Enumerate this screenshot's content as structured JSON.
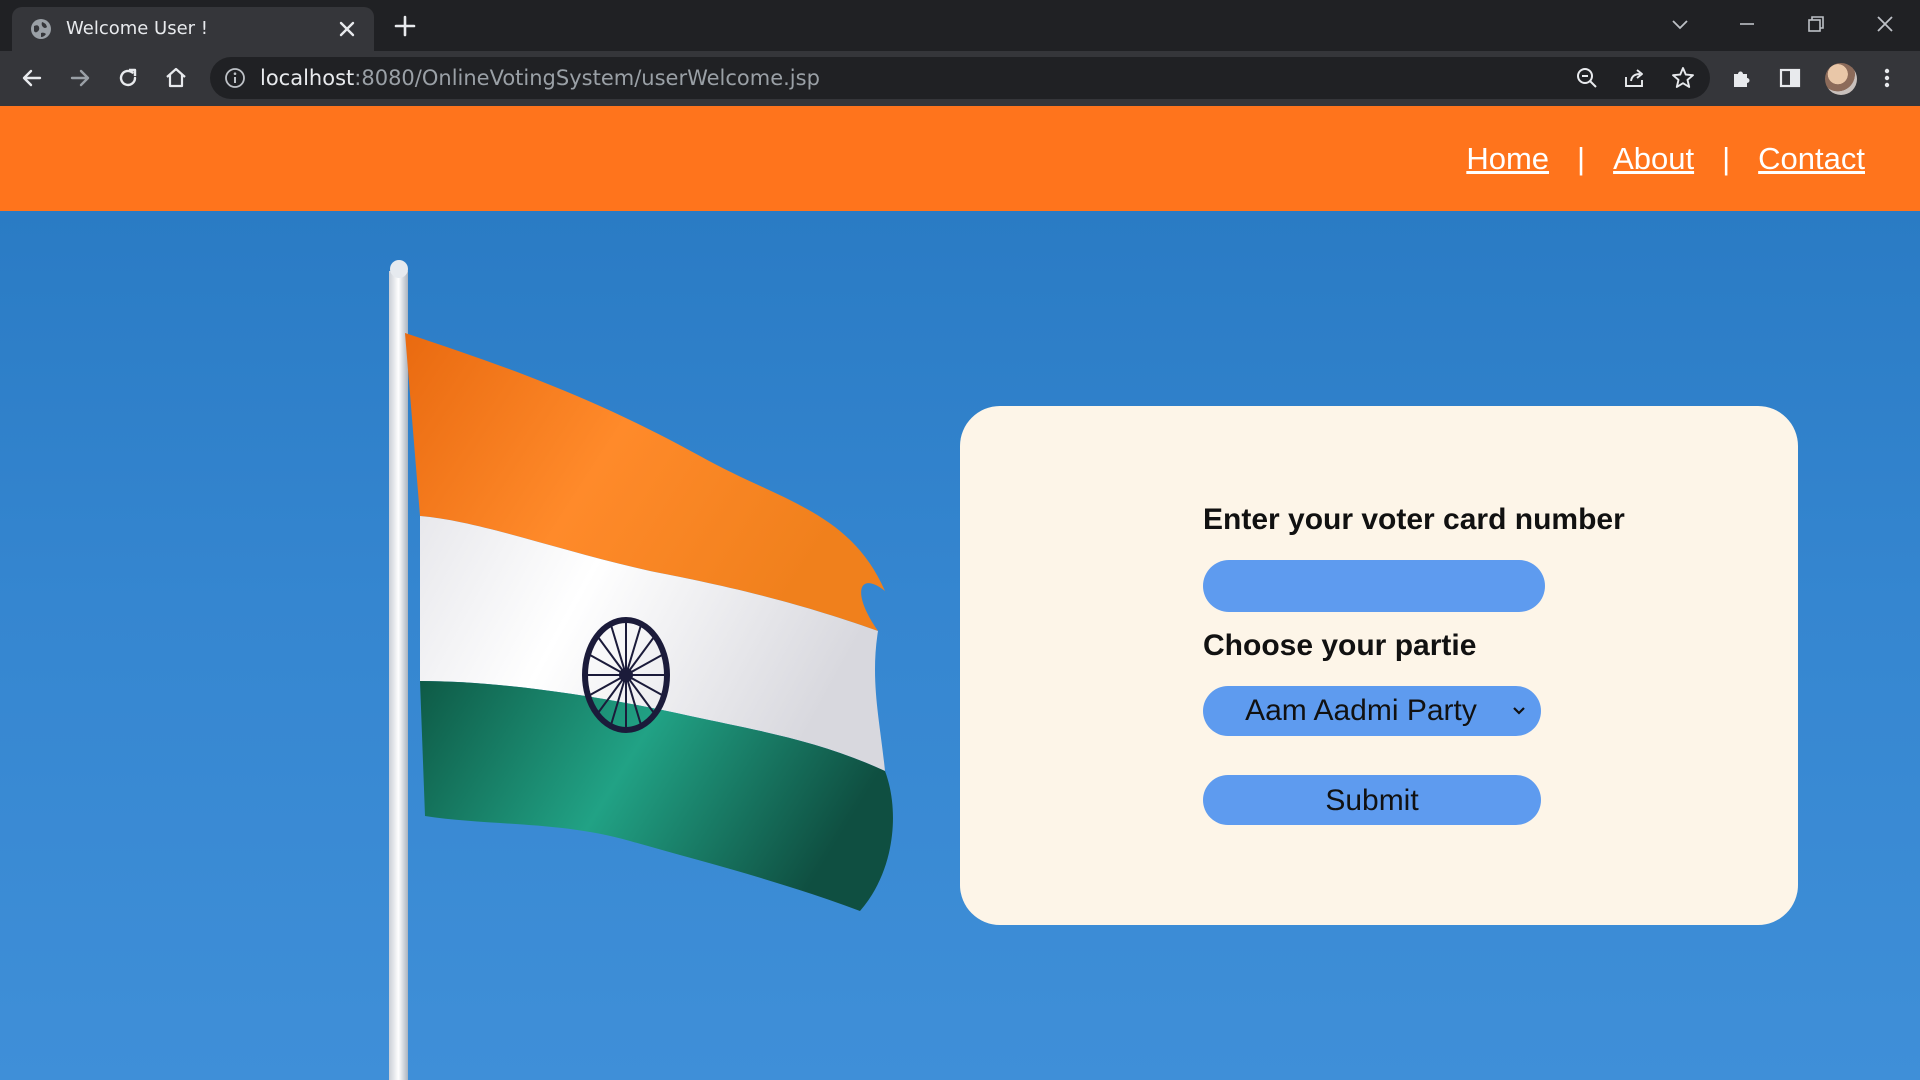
{
  "browser": {
    "tab_title": "Welcome User !",
    "url_host": "localhost",
    "url_path": ":8080/OnlineVotingSystem/userWelcome.jsp"
  },
  "nav": {
    "home": "Home",
    "about": "About",
    "contact": "Contact",
    "separator": "|"
  },
  "form": {
    "voter_label": "Enter your voter card number",
    "voter_value": "",
    "party_label": "Choose your partie",
    "party_selected": "Aam Aadmi Party",
    "submit_label": "Submit"
  },
  "colors": {
    "navbar": "#ff741c",
    "card": "#fdf5e8",
    "control": "#5e9bef",
    "sky": "#3586d0"
  },
  "icons": [
    "globe-icon",
    "close-icon",
    "plus-icon",
    "back-arrow-icon",
    "forward-arrow-icon",
    "reload-icon",
    "home-icon",
    "info-icon",
    "zoom-icon",
    "share-icon",
    "star-icon",
    "puzzle-icon",
    "side-panel-icon",
    "menu-dots-icon",
    "chevron-down-icon"
  ]
}
